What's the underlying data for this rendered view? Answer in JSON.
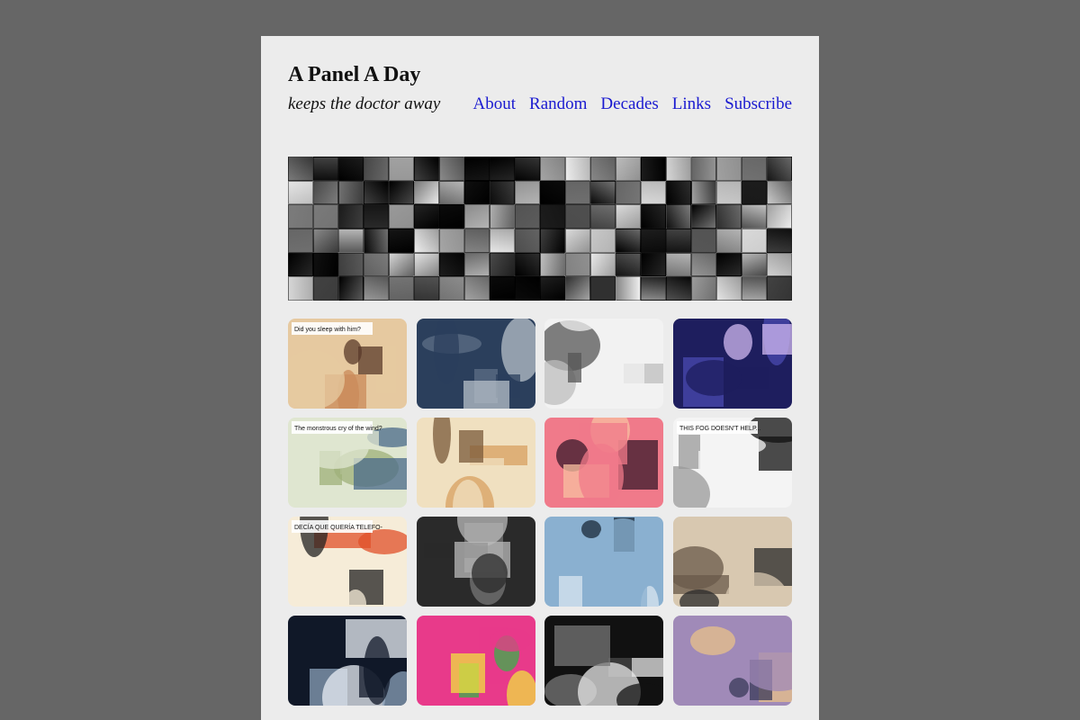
{
  "site": {
    "title": "A Panel A Day",
    "tagline": "keeps the doctor away"
  },
  "nav": {
    "items": [
      {
        "label": "About",
        "name": "nav-about"
      },
      {
        "label": "Random",
        "name": "nav-random"
      },
      {
        "label": "Decades",
        "name": "nav-decades"
      },
      {
        "label": "Links",
        "name": "nav-links"
      },
      {
        "label": "Subscribe",
        "name": "nav-subscribe"
      }
    ]
  },
  "colors": {
    "background": "#666666",
    "page": "#ececec",
    "link": "#1a1ad0"
  },
  "thumbnails": [
    {
      "name": "panel-thumb-1",
      "palette": [
        "#e6c9a0",
        "#c98a5a",
        "#5a3a2a"
      ],
      "caption": "Did you sleep with him?"
    },
    {
      "name": "panel-thumb-2",
      "palette": [
        "#2b3f5c",
        "#5d6f85",
        "#b7c0c8"
      ],
      "caption": ""
    },
    {
      "name": "panel-thumb-3",
      "palette": [
        "#f2f2f2",
        "#bdbdbd",
        "#555555"
      ],
      "caption": ""
    },
    {
      "name": "panel-thumb-4",
      "palette": [
        "#1e1e5e",
        "#4a4ab0",
        "#d0b8f0"
      ],
      "caption": ""
    },
    {
      "name": "panel-thumb-5",
      "palette": [
        "#dfe6d0",
        "#9fb07a",
        "#4a6a8a"
      ],
      "caption": "The monstrous cry of the wind?"
    },
    {
      "name": "panel-thumb-6",
      "palette": [
        "#f0e0c0",
        "#d8a060",
        "#7a5a3a"
      ],
      "caption": ""
    },
    {
      "name": "panel-thumb-7",
      "palette": [
        "#f07a8a",
        "#3a1a2a",
        "#f8c0a0"
      ],
      "caption": ""
    },
    {
      "name": "panel-thumb-8",
      "palette": [
        "#f4f4f4",
        "#999999",
        "#111111"
      ],
      "caption": "THIS FOG DOESN'T HELP..."
    },
    {
      "name": "panel-thumb-9",
      "palette": [
        "#f6ecd8",
        "#e0502a",
        "#222222"
      ],
      "caption": "DECÍA QUE QUERÍA TELEFO-"
    },
    {
      "name": "panel-thumb-10",
      "palette": [
        "#2a2a2a",
        "#777777",
        "#bbbbbb"
      ],
      "caption": ""
    },
    {
      "name": "panel-thumb-11",
      "palette": [
        "#8ab0d0",
        "#1a2a3a",
        "#d8e6f0"
      ],
      "caption": ""
    },
    {
      "name": "panel-thumb-12",
      "palette": [
        "#d8c8b0",
        "#6a5a4a",
        "#2a2a2a"
      ],
      "caption": ""
    },
    {
      "name": "panel-thumb-13",
      "palette": [
        "#101828",
        "#8aa0b8",
        "#e8eef4"
      ],
      "caption": ""
    },
    {
      "name": "panel-thumb-14",
      "palette": [
        "#e83a8a",
        "#3ab04a",
        "#f0e040"
      ],
      "caption": ""
    },
    {
      "name": "panel-thumb-15",
      "palette": [
        "#111111",
        "#e8e8e8",
        "#777777"
      ],
      "caption": ""
    },
    {
      "name": "panel-thumb-16",
      "palette": [
        "#a08ab8",
        "#e8c08a",
        "#3a3a5a"
      ],
      "caption": ""
    }
  ]
}
